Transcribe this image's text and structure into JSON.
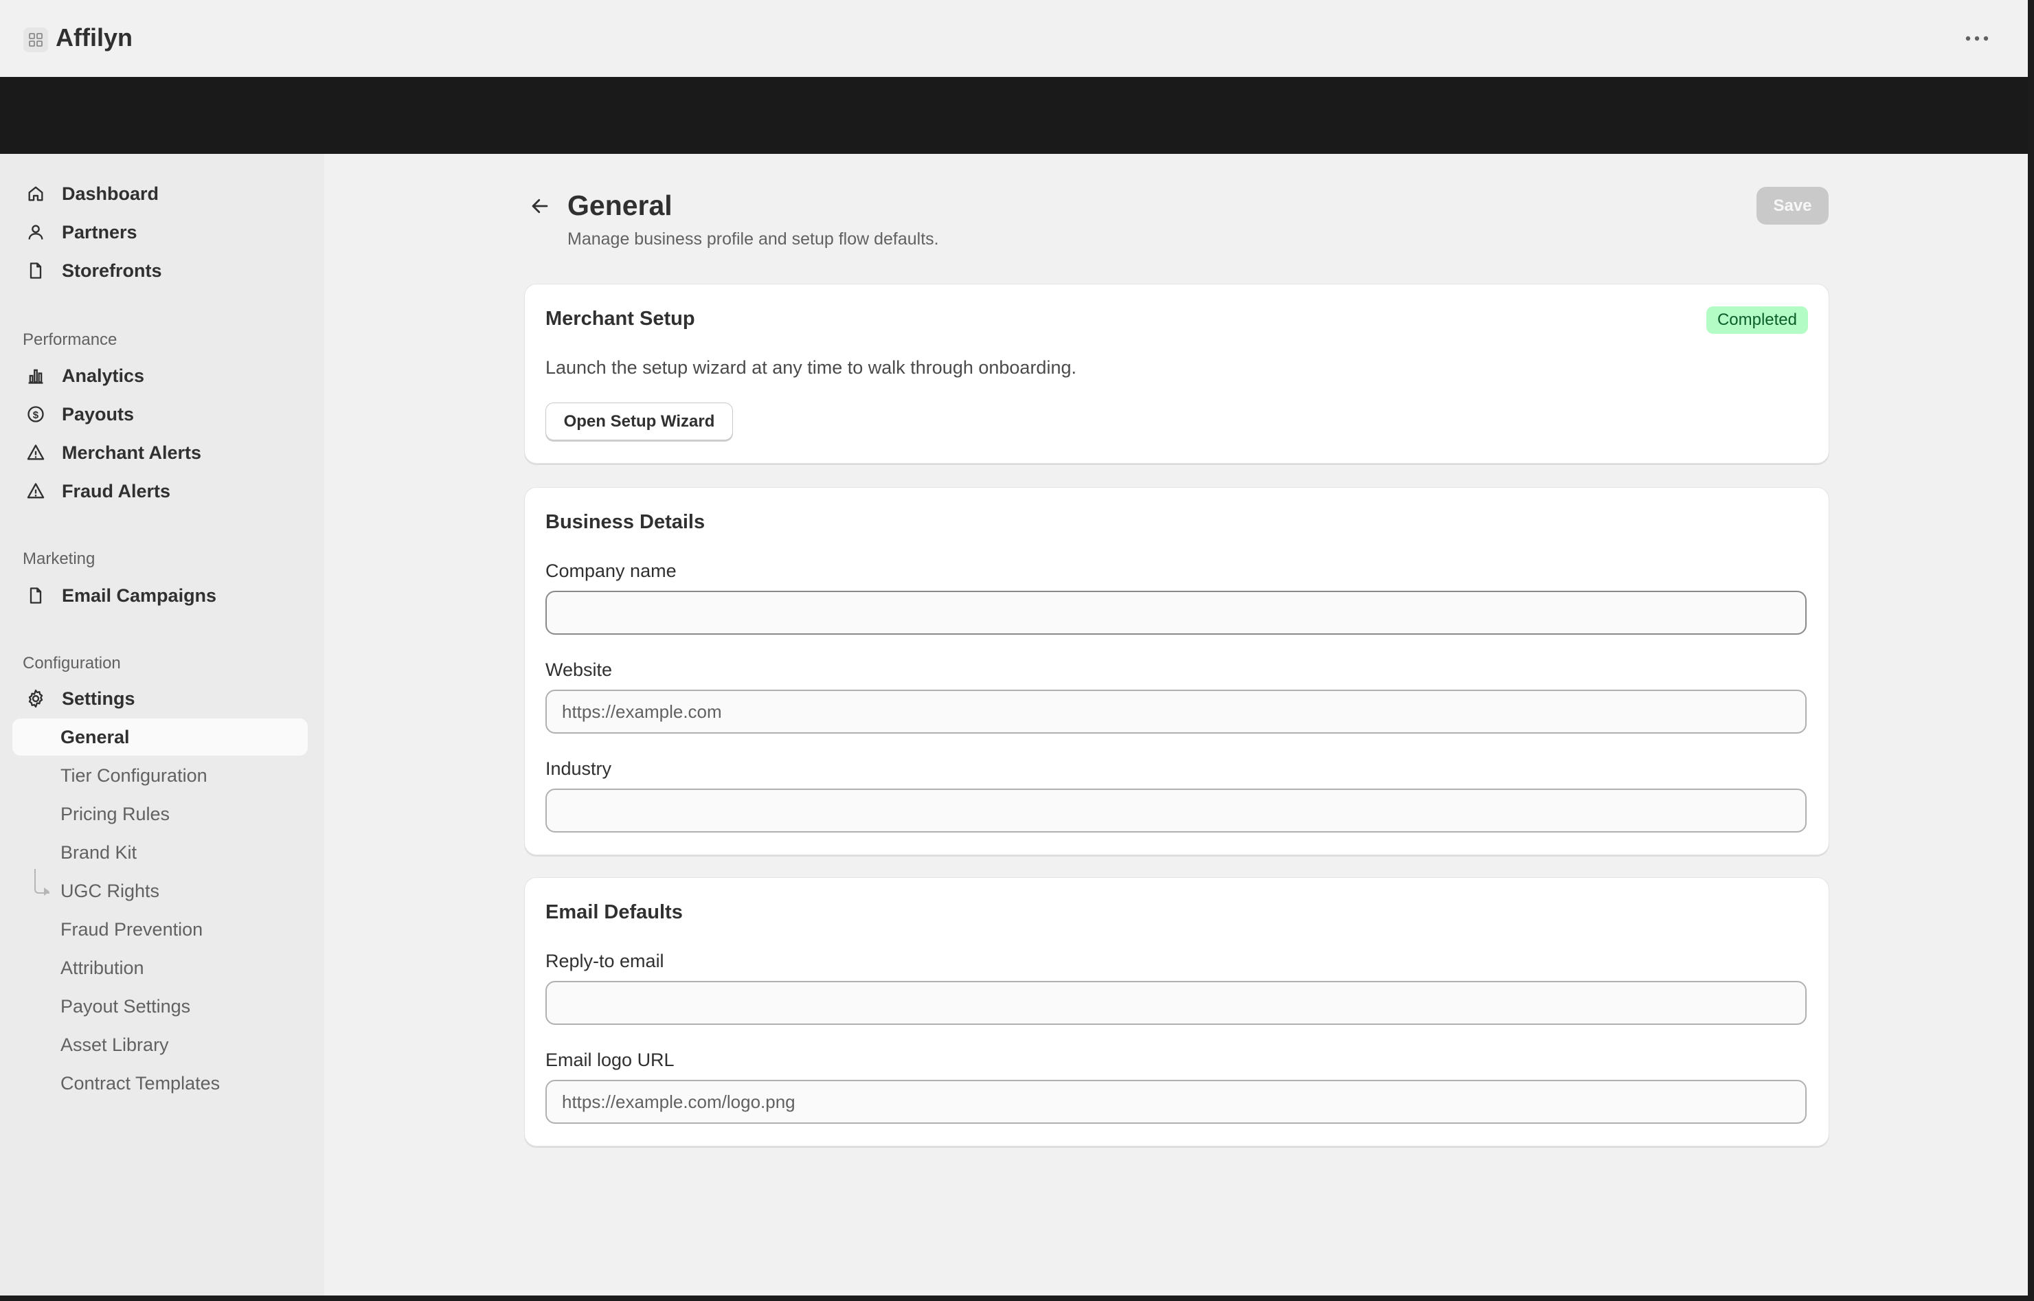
{
  "app": {
    "title": "Affilyn",
    "icon": "app-grid-icon",
    "menu_icon": "more-horizontal-icon"
  },
  "sidebar": {
    "primary": [
      {
        "label": "Dashboard",
        "icon": "home-icon"
      },
      {
        "label": "Partners",
        "icon": "person-icon"
      },
      {
        "label": "Storefronts",
        "icon": "file-icon"
      }
    ],
    "sections": [
      {
        "heading": "Performance",
        "items": [
          {
            "label": "Analytics",
            "icon": "bar-chart-icon"
          },
          {
            "label": "Payouts",
            "icon": "dollar-circle-icon"
          },
          {
            "label": "Merchant Alerts",
            "icon": "alert-triangle-icon"
          },
          {
            "label": "Fraud Alerts",
            "icon": "alert-triangle-icon"
          }
        ]
      },
      {
        "heading": "Marketing",
        "items": [
          {
            "label": "Email Campaigns",
            "icon": "file-icon"
          }
        ]
      },
      {
        "heading": "Configuration",
        "items": [
          {
            "label": "Settings",
            "icon": "gear-icon"
          }
        ]
      }
    ],
    "settings_sub": [
      {
        "label": "General",
        "active": true
      },
      {
        "label": "Tier Configuration"
      },
      {
        "label": "Pricing Rules"
      },
      {
        "label": "Brand Kit"
      },
      {
        "label": "UGC Rights"
      },
      {
        "label": "Fraud Prevention"
      },
      {
        "label": "Attribution"
      },
      {
        "label": "Payout Settings"
      },
      {
        "label": "Asset Library"
      },
      {
        "label": "Contract Templates"
      }
    ]
  },
  "page": {
    "title": "General",
    "subtitle": "Manage business profile and setup flow defaults.",
    "save_label": "Save",
    "back_icon": "arrow-left-icon"
  },
  "merchant_setup": {
    "title": "Merchant Setup",
    "status": "Completed",
    "description": "Launch the setup wizard at any time to walk through onboarding.",
    "button": "Open Setup Wizard"
  },
  "business_details": {
    "title": "Business Details",
    "company_label": "Company name",
    "company_value": "",
    "website_label": "Website",
    "website_placeholder": "https://example.com",
    "industry_label": "Industry",
    "industry_value": ""
  },
  "email_defaults": {
    "title": "Email Defaults",
    "reply_label": "Reply-to email",
    "reply_value": "",
    "logo_label": "Email logo URL",
    "logo_placeholder": "https://example.com/logo.png"
  },
  "colors": {
    "dark_band": "#1a1a1a",
    "badge_bg": "#b4fcc5",
    "badge_text": "#0b5e2a",
    "save_disabled": "#c9c9c9"
  }
}
